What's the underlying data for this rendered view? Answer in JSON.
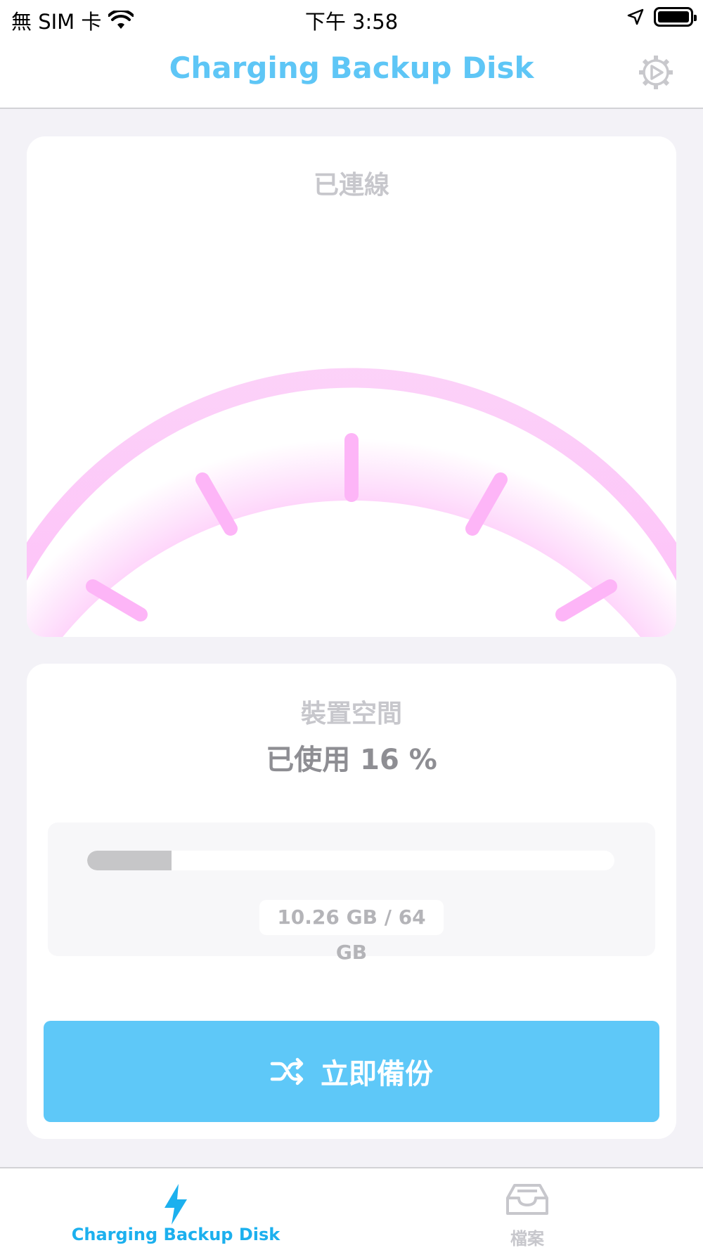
{
  "status_bar": {
    "carrier": "無 SIM 卡",
    "time": "下午 3:58"
  },
  "nav": {
    "title": "Charging Backup Disk",
    "settings_icon": "gear-icon"
  },
  "connection": {
    "status": "已連線",
    "gauge_color": "#fdb5f7"
  },
  "storage": {
    "title": "裝置空間",
    "used_text": "已使用 16 %",
    "used_percent": 16,
    "capacity_text": "10.26 GB / 64 GB"
  },
  "backup_button": {
    "label": "立即備份",
    "icon": "shuffle-icon"
  },
  "tabs": [
    {
      "label": "Charging Backup Disk",
      "icon": "lightning-icon",
      "active": true
    },
    {
      "label": "檔案",
      "icon": "inbox-tray-icon",
      "active": false
    }
  ],
  "colors": {
    "accent": "#5ec8f8",
    "active_tab": "#1cb0ee",
    "gauge_pink": "#fdb5f7",
    "inactive": "#c7c7cc"
  }
}
